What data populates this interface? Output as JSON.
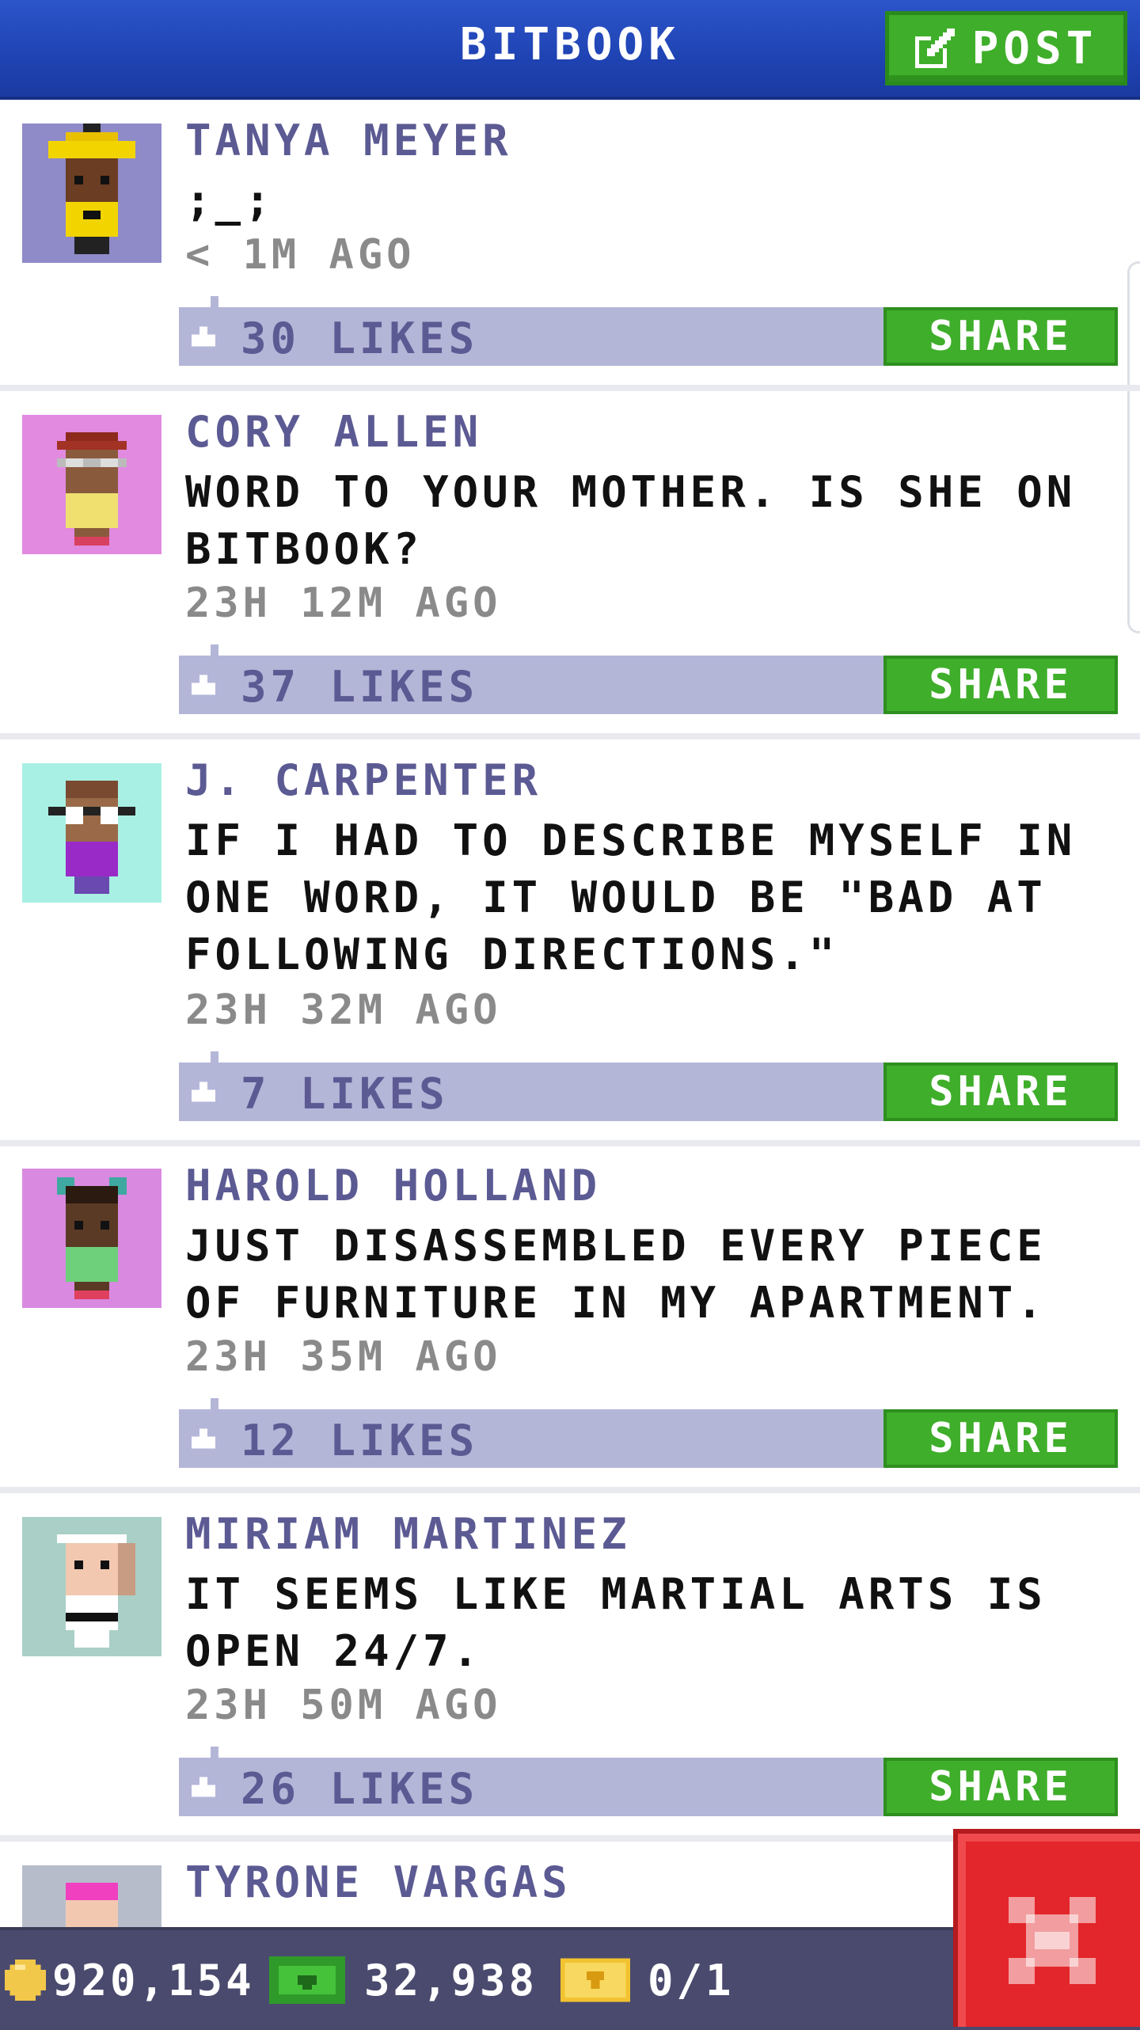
{
  "header": {
    "title": "BITBOOK",
    "post_label": "POST"
  },
  "posts": [
    {
      "name": "TANYA MEYER",
      "text": ";_;",
      "time": "< 1M AGO",
      "likes": "30 LIKES",
      "share": "SHARE",
      "avatar_bg": "#8f8ac8"
    },
    {
      "name": "CORY ALLEN",
      "text": "WORD TO YOUR MOTHER. IS SHE ON BITBOOK?",
      "time": "23H 12M AGO",
      "likes": "37 LIKES",
      "share": "SHARE",
      "avatar_bg": "#e18ae0"
    },
    {
      "name": "J. CARPENTER",
      "text": "IF I HAD TO DESCRIBE MYSELF IN ONE WORD, IT WOULD BE \"BAD AT FOLLOWING DIRECTIONS.\"",
      "time": "23H 32M AGO",
      "likes": "7 LIKES",
      "share": "SHARE",
      "avatar_bg": "#a8f0e4"
    },
    {
      "name": "HAROLD HOLLAND",
      "text": "JUST DISASSEMBLED EVERY PIECE OF FURNITURE IN MY APARTMENT.",
      "time": "23H 35M AGO",
      "likes": "12 LIKES",
      "share": "SHARE",
      "avatar_bg": "#d98ae0"
    },
    {
      "name": "MIRIAM MARTINEZ",
      "text": "IT SEEMS LIKE MARTIAL ARTS IS OPEN 24/7.",
      "time": "23H 50M AGO",
      "likes": "26 LIKES",
      "share": "SHARE",
      "avatar_bg": "#a9cfc6"
    },
    {
      "name": "TYRONE VARGAS",
      "text": "",
      "time": "",
      "likes": "",
      "share": "",
      "avatar_bg": "#b7bccb"
    }
  ],
  "status": {
    "coins": "920,154",
    "bux": "32,938",
    "tickets": "0/1"
  },
  "colors": {
    "header": "#1f43b3",
    "accent_green": "#3fae2a",
    "likes_bar": "#b4b6d8",
    "name_text": "#5b5a93",
    "close_red": "#e3262b"
  },
  "icons": [
    "edit-icon",
    "like-icon",
    "coin-icon",
    "cash-icon",
    "ticket-icon",
    "close-icon"
  ]
}
